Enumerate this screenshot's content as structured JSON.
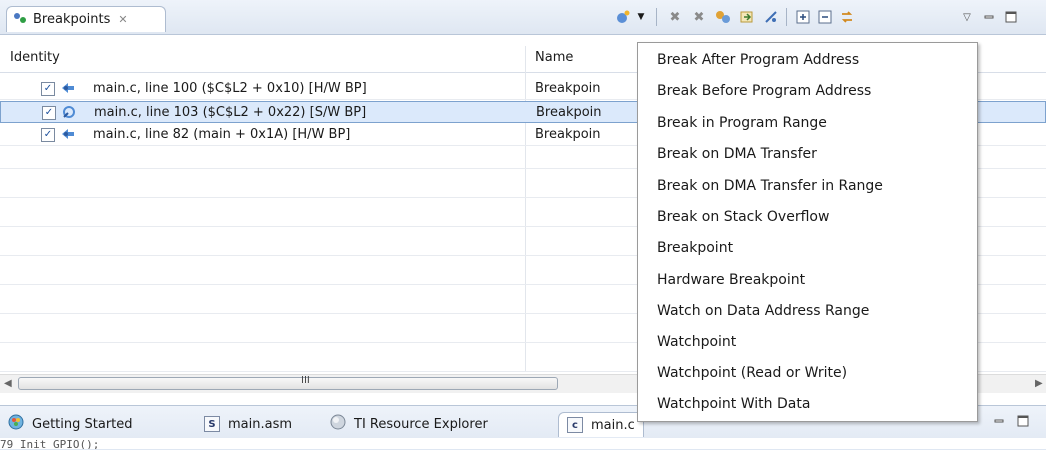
{
  "view_tab": {
    "label": "Breakpoints",
    "close": "✕"
  },
  "table": {
    "columns": [
      "Identity",
      "Name"
    ],
    "rows": [
      {
        "checked": "✓",
        "identity": "main.c, line 100 ($C$L2 + 0x10)  [H/W BP]",
        "name": "Breakpoin",
        "type": "hardware",
        "selected": false
      },
      {
        "checked": "✓",
        "identity": "main.c, line 103 ($C$L2 + 0x22)  [S/W BP]",
        "name": "Breakpoin",
        "type": "software",
        "selected": true
      },
      {
        "checked": "✓",
        "identity": "main.c, line 82 (main + 0x1A)  [H/W BP]",
        "name": "Breakpoin",
        "type": "hardware",
        "selected": false
      }
    ]
  },
  "scrollbar": {
    "grip": "III"
  },
  "menu": {
    "items": [
      "Break After Program Address",
      "Break Before Program Address",
      "Break in Program Range",
      "Break on DMA Transfer",
      "Break on DMA Transfer in Range",
      "Break on Stack Overflow",
      "Breakpoint",
      "Hardware Breakpoint",
      "Watch on Data Address Range",
      "Watchpoint",
      "Watchpoint (Read or Write)",
      "Watchpoint With Data"
    ]
  },
  "editor_tabs": [
    {
      "label": "Getting Started",
      "icon": "getting-started-icon"
    },
    {
      "label": "main.asm",
      "icon": "asm-file-icon",
      "icon_text": "S"
    },
    {
      "label": "TI Resource Explorer",
      "icon": "resource-explorer-icon"
    },
    {
      "label": "main.c",
      "icon": "c-file-icon",
      "icon_text": "c",
      "active": true
    }
  ],
  "code_preview": "  79            Init_GPIO();",
  "colors": {
    "selection": "#dbe9fb",
    "selection_border": "#7da2ce",
    "tab_bar": "#dfe7f2"
  }
}
